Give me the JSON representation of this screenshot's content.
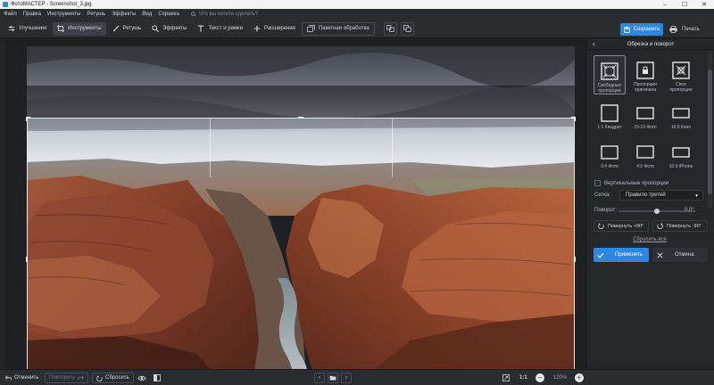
{
  "window": {
    "title": "ФотоМАСТЕР - Screenshot_3.jpg",
    "controls": [
      "–",
      "☐",
      "✕"
    ]
  },
  "menu": {
    "items": [
      "Файл",
      "Правка",
      "Инструменты",
      "Ретушь",
      "Эффекты",
      "Вид",
      "Справка"
    ],
    "search_placeholder": "Что вы хотите сделать?"
  },
  "toolbar": {
    "improve": "Улучшения",
    "tools": "Инструменты",
    "retouch": "Ретушь",
    "effects": "Эффекты",
    "text": "Текст и рамки",
    "plugins": "Расширения",
    "batch": "Пакетная обработка",
    "save": "Сохранить",
    "print": "Печать"
  },
  "panel": {
    "title": "Обрезка и поворот",
    "presets": [
      {
        "label": "Свободные пропорции",
        "icon": "free-crop-icon",
        "selected": true
      },
      {
        "label": "Пропорции оригинала",
        "icon": "lock-ratio-icon",
        "selected": false
      },
      {
        "label": "Свои пропорции",
        "icon": "custom-ratio-icon",
        "selected": false
      },
      {
        "label": "1:1 Квадрат",
        "icon": "square-ratio-icon",
        "selected": false
      },
      {
        "label": "15:10 Фото",
        "icon": "photo-15-10-icon",
        "selected": false
      },
      {
        "label": "16:9 Кино",
        "icon": "cinema-16-9-icon",
        "selected": false
      },
      {
        "label": "3:4 Фото",
        "icon": "photo-3-4-icon",
        "selected": false
      },
      {
        "label": "4:3 Фото",
        "icon": "photo-4-3-icon",
        "selected": false
      },
      {
        "label": "16:9 iPhone",
        "icon": "iphone-16-9-icon",
        "selected": false
      }
    ],
    "vertical_label": "Вертикальные пропорции",
    "grid_label": "Сетка:",
    "grid_value": "Правило третей",
    "rotate_label": "Поворот:",
    "rotate_value": "0,0°",
    "rotate_value_level": 0.5,
    "rotate_left": "Повернуть +90°",
    "rotate_right": "Повернуть -90°",
    "reset_all": "Сбросить все",
    "apply": "Применить",
    "cancel": "Отмена"
  },
  "bottom": {
    "undo": "Отменить",
    "redo": "Повторить",
    "reset": "Сбросить",
    "zoom_ratio": "1:1",
    "zoom_value": "120%"
  },
  "colors": {
    "accent": "#2e86de",
    "background": "#1e1f22",
    "panel": "#26272b"
  }
}
